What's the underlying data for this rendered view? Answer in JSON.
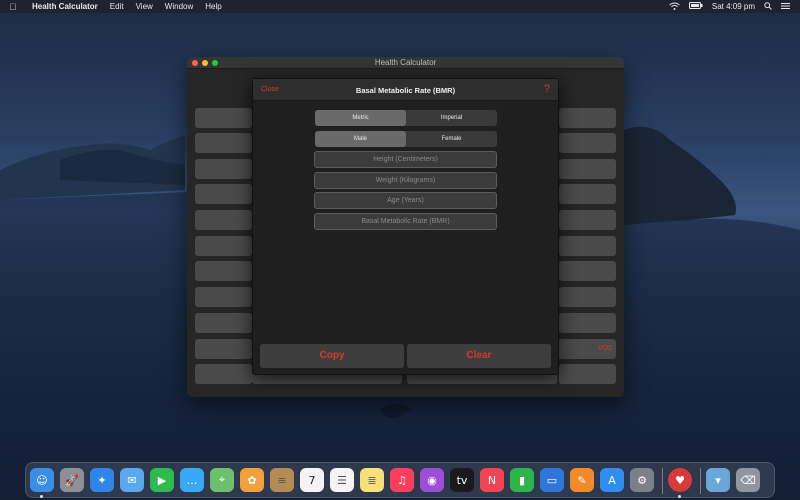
{
  "menubar": {
    "app_name": "Health Calculator",
    "menus": [
      "Edit",
      "View",
      "Window",
      "Help"
    ],
    "clock": "Sat 4:09 pm"
  },
  "window": {
    "title": "Health Calculator",
    "background_right_labels": {
      "red_label": "VO2"
    }
  },
  "sheet": {
    "close_label": "Close",
    "title": "Basal Metabolic Rate (BMR)",
    "help_label": "?",
    "units": {
      "options": [
        "Metric",
        "Imperial"
      ],
      "selected": "Metric"
    },
    "gender": {
      "options": [
        "Male",
        "Female"
      ],
      "selected": "Male"
    },
    "fields": [
      {
        "placeholder": "Height (Centimeters)"
      },
      {
        "placeholder": "Weight (Kilograms)"
      },
      {
        "placeholder": "Age (Years)"
      },
      {
        "placeholder": "Basal Metabolic Rate (BMR)"
      }
    ],
    "copy_label": "Copy",
    "clear_label": "Clear"
  },
  "colors": {
    "accent": "#d43a2f",
    "selected_segment": "#6a6a6a"
  },
  "dock": {
    "apps": [
      "finder-icon",
      "launchpad-icon",
      "safari-icon",
      "mail-icon",
      "facetime-icon",
      "messages-icon",
      "maps-icon",
      "photos-icon",
      "contacts-icon",
      "calendar-icon",
      "reminders-icon",
      "notes-icon",
      "music-icon",
      "podcasts-icon",
      "tv-icon",
      "news-icon",
      "numbers-icon",
      "keynote-icon",
      "pages-icon",
      "app-store-icon",
      "system-preferences-icon",
      "health-calculator-icon",
      "downloads-folder-icon",
      "trash-icon"
    ],
    "calendar_day": "7",
    "tv_label": "tv"
  }
}
